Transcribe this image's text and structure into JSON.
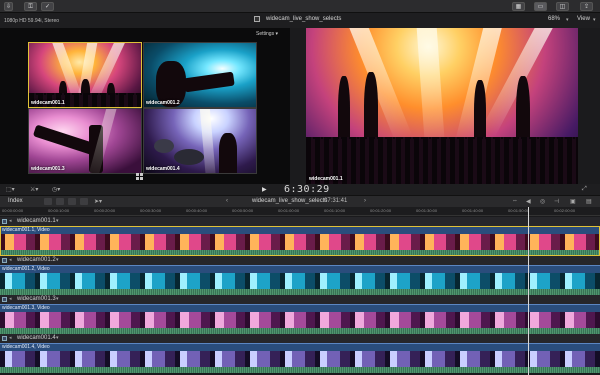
{
  "toolbar": {
    "left_buttons": [
      "keyword",
      "done"
    ],
    "right_buttons": [
      "browser-layout",
      "viewer-layout",
      "inspector-layout",
      "share"
    ]
  },
  "viewer": {
    "format": "1080p HD 59.94i, Stereo",
    "project_title": "widecam_live_show_selects",
    "zoom": "68%",
    "view_label": "View",
    "settings_label": "Settings",
    "angles": [
      {
        "label": "widecam001.1"
      },
      {
        "label": "widecam001.2"
      },
      {
        "label": "widecam001.3"
      },
      {
        "label": "widecam001.4"
      }
    ],
    "main_label": "widecam001.1"
  },
  "transport": {
    "timecode": "6:30:29"
  },
  "timeline": {
    "index_label": "Index",
    "sequence_title": "widecam_live_show_selects",
    "duration": "07:31:41",
    "ruler_ticks": [
      "00:00:00:00",
      "00:00:10:00",
      "00:00:20:00",
      "00:00:30:00",
      "00:00:40:00",
      "00:00:50:00",
      "00:01:00:00",
      "00:01:10:00",
      "00:01:20:00",
      "00:01:30:00",
      "00:01:40:00",
      "00:01:50:00",
      "00:02:00:00"
    ],
    "tracks": [
      {
        "name": "widecam001.1",
        "clip": "widecam001.1, Video"
      },
      {
        "name": "widecam001.2",
        "clip": "widecam001.2, Video"
      },
      {
        "name": "widecam001.3",
        "clip": "widecam001.3, Video"
      },
      {
        "name": "widecam001.4",
        "clip": "widecam001.4, Video"
      }
    ]
  }
}
